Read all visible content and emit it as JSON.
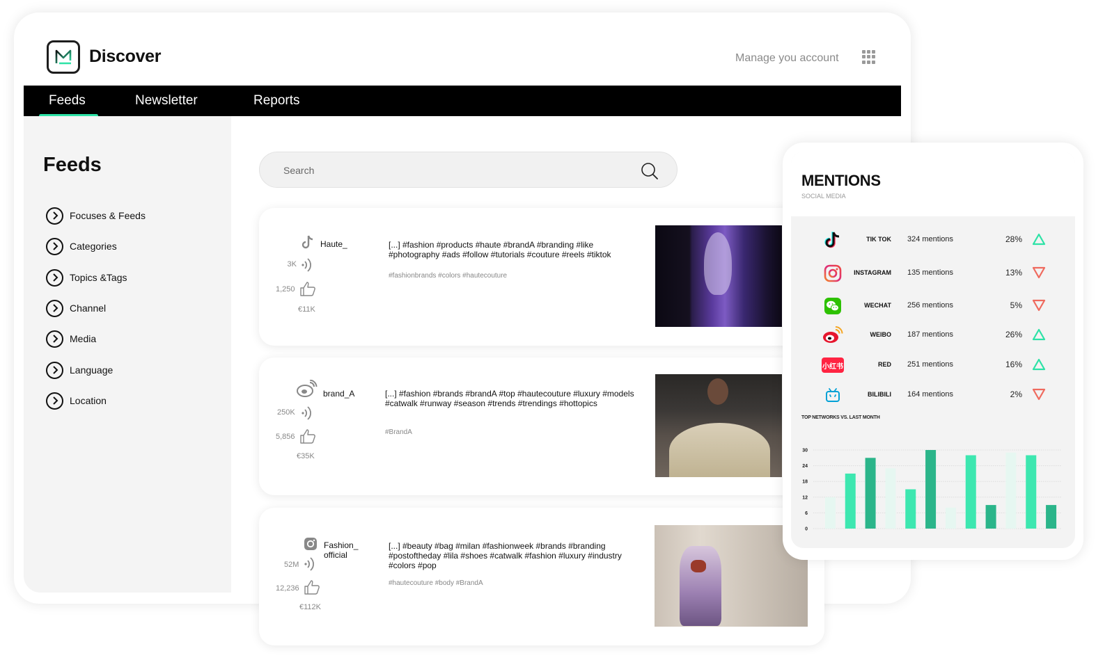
{
  "app": {
    "brand": "Discover",
    "account_link": "Manage you account"
  },
  "nav": {
    "tabs": [
      {
        "label": "Feeds",
        "active": true
      },
      {
        "label": "Newsletter"
      },
      {
        "label": "Reports"
      }
    ]
  },
  "sidebar": {
    "title": "Feeds",
    "items": [
      {
        "label": "Focuses & Feeds"
      },
      {
        "label": "Categories"
      },
      {
        "label": "Topics &Tags"
      },
      {
        "label": "Channel"
      },
      {
        "label": "Media"
      },
      {
        "label": "Language"
      },
      {
        "label": "Location"
      }
    ]
  },
  "search": {
    "placeholder": "Search"
  },
  "feeds": [
    {
      "network": "tiktok",
      "handle": "Haute_",
      "reach": "3K",
      "likes": "1,250",
      "value": "€11K",
      "text": "[...] #fashion #products #haute #brandA #branding #like #photography #ads #follow #tutorials #couture #reels #tiktok",
      "tags": "#fashionbrands #colors #hautecouture"
    },
    {
      "network": "weibo",
      "handle": "brand_A",
      "reach": "250K",
      "likes": "5,856",
      "value": "€35K",
      "text": "[...] #fashion #brands #brandA #top #hautecouture #luxury #models #catwalk #runway #season #trends #trendings #hottopics",
      "tags": "#BrandA"
    },
    {
      "network": "instagram",
      "handle": "Fashion_ official",
      "reach": "52M",
      "likes": "12,236",
      "value": "€112K",
      "text": "[...] #beauty #bag #milan #fashionweek #brands #branding #postoftheday #lila #shoes #catwalk #fashion #luxury #industry #colors #pop",
      "tags": "#hautecouture #body #BrandA"
    }
  ],
  "mentions": {
    "title": "MENTIONS",
    "subtitle": "SOCIAL MEDIA",
    "rows": [
      {
        "network": "TIK TOK",
        "icon": "tiktok-icon",
        "mentions": "324 mentions",
        "pct": "28%",
        "trend": "up"
      },
      {
        "network": "INSTAGRAM",
        "icon": "instagram-icon",
        "mentions": "135 mentions",
        "pct": "13%",
        "trend": "down"
      },
      {
        "network": "WECHAT",
        "icon": "wechat-icon",
        "mentions": "256 mentions",
        "pct": "5%",
        "trend": "down"
      },
      {
        "network": "WEIBO",
        "icon": "weibo-icon",
        "mentions": "187 mentions",
        "pct": "26%",
        "trend": "up"
      },
      {
        "network": "RED",
        "icon": "red-icon",
        "icon_text": "小红书",
        "mentions": "251 mentions",
        "pct": "16%",
        "trend": "up"
      },
      {
        "network": "BILIBILI",
        "icon": "bilibili-icon",
        "mentions": "164  mentions",
        "pct": "2%",
        "trend": "down"
      }
    ],
    "colors": {
      "up": "#2de2a6",
      "down": "#ef6a5e"
    }
  },
  "chart_data": {
    "type": "bar",
    "title": "TOP NETWORKS VS. LAST MONTH",
    "xlabel": "",
    "ylabel": "",
    "ylim": [
      0,
      30
    ],
    "yticks": [
      0,
      6,
      12,
      18,
      24,
      30
    ],
    "categories": [
      "",
      "",
      "",
      "",
      "",
      "",
      "",
      "",
      "",
      "",
      "",
      ""
    ],
    "series": [
      {
        "values": [
          12,
          21,
          27,
          23,
          15,
          30,
          8,
          28,
          9,
          29,
          28,
          9
        ]
      }
    ],
    "bar_colors": [
      "#e6f7f1",
      "#3de7b0",
      "#2bb58a",
      "#e6f7f1",
      "#3de7b0",
      "#2bb58a",
      "#e6f7f1",
      "#3de7b0",
      "#2bb58a",
      "#e6f7f1",
      "#3de7b0",
      "#2bb58a"
    ],
    "grid": true
  }
}
